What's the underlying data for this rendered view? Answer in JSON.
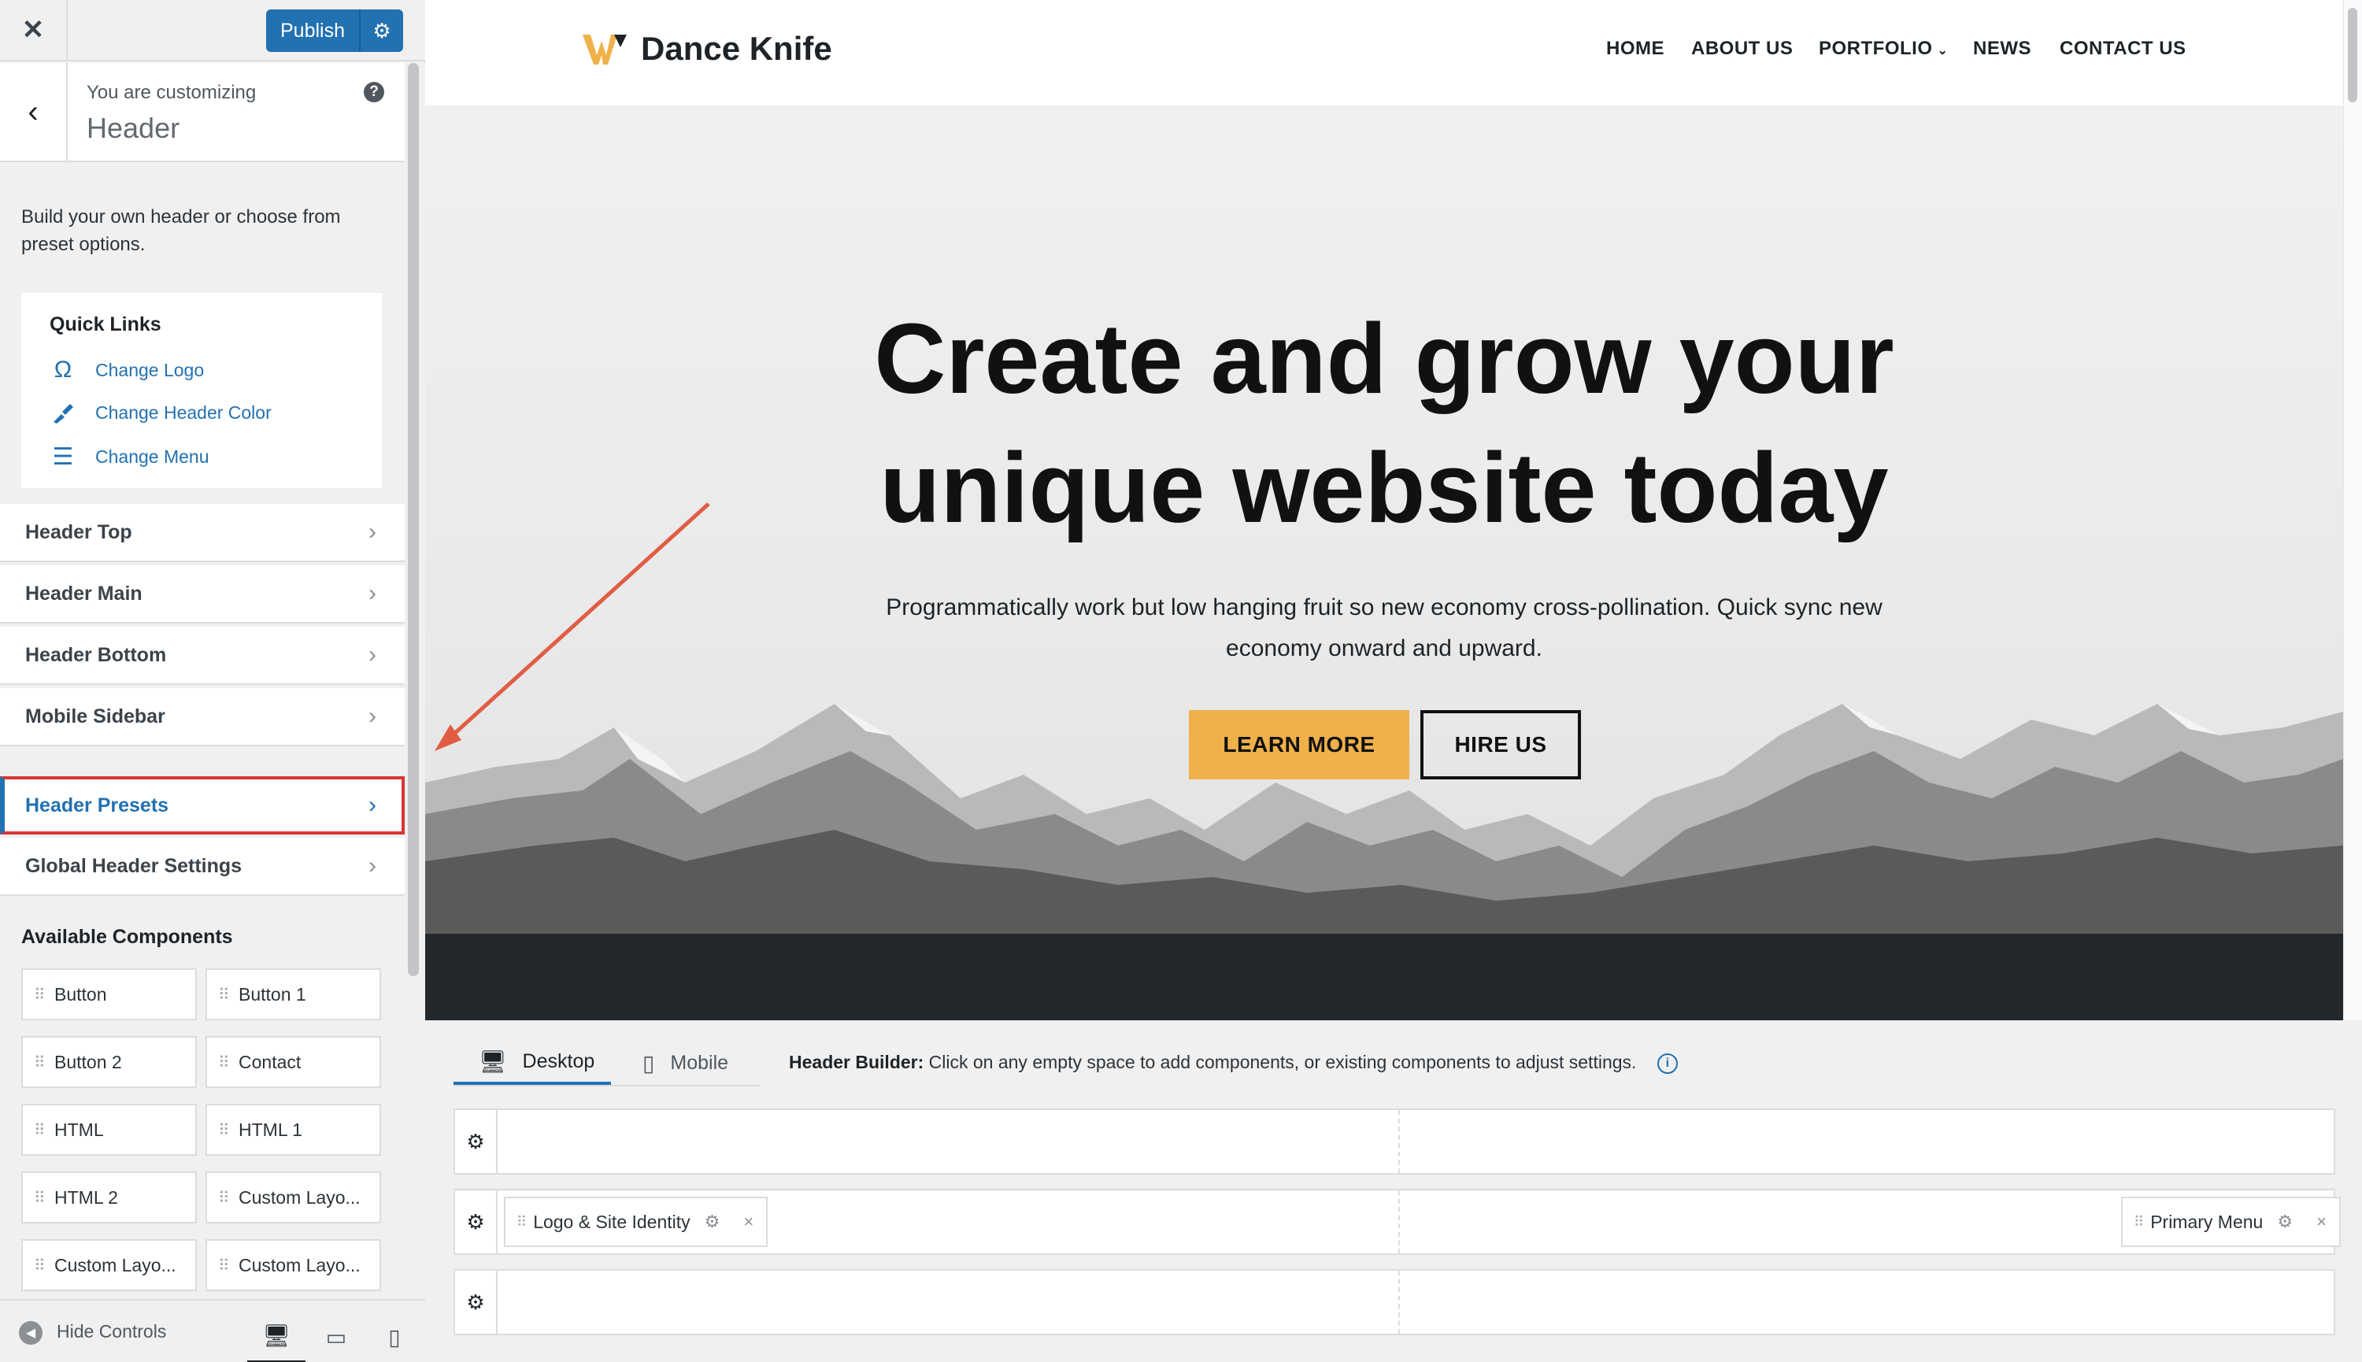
{
  "sidebar": {
    "close_label": "✕",
    "publish_label": "Publish",
    "publish_settings_icon": "⚙",
    "back_icon": "‹",
    "customizing_label": "You are customizing",
    "customizing_title": "Header",
    "help_icon": "?",
    "description": "Build your own header or choose from preset options.",
    "quick_links": {
      "title": "Quick Links",
      "items": [
        {
          "label": "Change Logo",
          "icon": "Ω"
        },
        {
          "label": "Change Header Color",
          "icon": "🖌"
        },
        {
          "label": "Change Menu",
          "icon": "☰"
        }
      ]
    },
    "sections": [
      {
        "label": "Header Top"
      },
      {
        "label": "Header Main"
      },
      {
        "label": "Header Bottom"
      },
      {
        "label": "Mobile Sidebar"
      }
    ],
    "sections2": [
      {
        "label": "Header Presets"
      },
      {
        "label": "Global Header Settings"
      }
    ],
    "chevron": "›",
    "available_title": "Available Components",
    "components": [
      {
        "label": "Button"
      },
      {
        "label": "Button 1"
      },
      {
        "label": "Button 2"
      },
      {
        "label": "Contact"
      },
      {
        "label": "HTML"
      },
      {
        "label": "HTML 1"
      },
      {
        "label": "HTML 2"
      },
      {
        "label": "Custom Layo..."
      },
      {
        "label": "Custom Layo..."
      },
      {
        "label": "Custom Layo..."
      }
    ],
    "drag_glyph": "⠿",
    "footer": {
      "hide_label": "Hide Controls",
      "hide_icon": "◀",
      "devices": [
        "🖥",
        "▭",
        "▯"
      ]
    }
  },
  "preview": {
    "site_title": "Dance Knife",
    "nav": [
      "HOME",
      "ABOUT US",
      "PORTFOLIO",
      "NEWS",
      "CONTACT US"
    ],
    "nav_caret": "⌄",
    "hero_title_line1": "Create and grow your",
    "hero_title_line2": "unique website today",
    "hero_sub_line1": "Programmatically work but low hanging fruit so new economy cross-pollination. Quick sync new",
    "hero_sub_line2": "economy onward and upward.",
    "btn_learn": "LEARN MORE",
    "btn_hire": "HIRE US",
    "accent_color": "#f0b14a"
  },
  "builder": {
    "tab_desktop": "Desktop",
    "tab_mobile": "Mobile",
    "note_bold": "Header Builder:",
    "note_text": "Click on any empty space to add components, or existing components to adjust settings.",
    "info_icon": "i",
    "gear_glyph": "⚙",
    "close_glyph": "×",
    "chip_logo": "Logo & Site Identity",
    "chip_menu": "Primary Menu"
  },
  "colors": {
    "wp_blue": "#2271b1",
    "highlight_red": "#d63638",
    "arrow_color": "#e05d44"
  }
}
